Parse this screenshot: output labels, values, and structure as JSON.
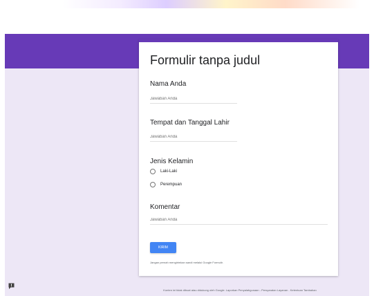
{
  "form": {
    "title": "Formulir tanpa judul",
    "questions": [
      {
        "label": "Nama Anda",
        "placeholder": "Jawaban Anda"
      },
      {
        "label": "Tempat dan Tanggal Lahir",
        "placeholder": "Jawaban Anda"
      },
      {
        "label": "Jenis Kelamin",
        "options": [
          "Laki-Laki",
          "Perempuan"
        ]
      },
      {
        "label": "Komentar",
        "placeholder": "Jawaban Anda"
      }
    ],
    "submit_label": "KIRIM",
    "password_note": "Jangan pernah mengirimkan sandi melalui Google Formulir."
  },
  "footer": {
    "text": "Konten ini tidak dibuat atau didukung oleh Google. Laporkan Penyalahgunaan - Persyaratan Layanan - Ketentuan Tambahan"
  },
  "colors": {
    "header": "#673ab7",
    "background": "#ede7f6",
    "submit": "#4285f4"
  },
  "icons": {
    "report": "report-feedback-icon"
  }
}
